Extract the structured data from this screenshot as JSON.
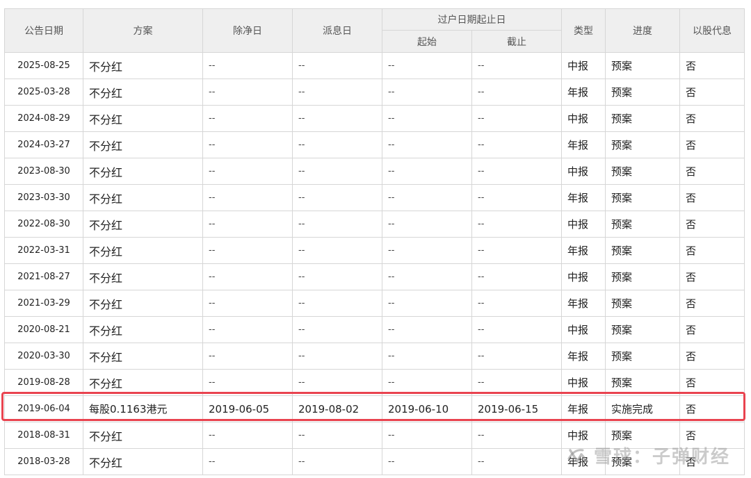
{
  "table": {
    "headers": {
      "announce_date": "公告日期",
      "plan": "方案",
      "ex_date": "除净日",
      "pay_date": "派息日",
      "transfer_period": "过户日期起止日",
      "transfer_start": "起始",
      "transfer_end": "截止",
      "type": "类型",
      "progress": "进度",
      "scrip": "以股代息"
    },
    "rows": [
      {
        "date": "2025-08-25",
        "plan": "不分红",
        "ex": "--",
        "pay": "--",
        "start": "--",
        "end": "--",
        "type": "中报",
        "progress": "预案",
        "scrip": "否"
      },
      {
        "date": "2025-03-28",
        "plan": "不分红",
        "ex": "--",
        "pay": "--",
        "start": "--",
        "end": "--",
        "type": "年报",
        "progress": "预案",
        "scrip": "否"
      },
      {
        "date": "2024-08-29",
        "plan": "不分红",
        "ex": "--",
        "pay": "--",
        "start": "--",
        "end": "--",
        "type": "中报",
        "progress": "预案",
        "scrip": "否"
      },
      {
        "date": "2024-03-27",
        "plan": "不分红",
        "ex": "--",
        "pay": "--",
        "start": "--",
        "end": "--",
        "type": "年报",
        "progress": "预案",
        "scrip": "否"
      },
      {
        "date": "2023-08-30",
        "plan": "不分红",
        "ex": "--",
        "pay": "--",
        "start": "--",
        "end": "--",
        "type": "中报",
        "progress": "预案",
        "scrip": "否"
      },
      {
        "date": "2023-03-30",
        "plan": "不分红",
        "ex": "--",
        "pay": "--",
        "start": "--",
        "end": "--",
        "type": "年报",
        "progress": "预案",
        "scrip": "否"
      },
      {
        "date": "2022-08-30",
        "plan": "不分红",
        "ex": "--",
        "pay": "--",
        "start": "--",
        "end": "--",
        "type": "中报",
        "progress": "预案",
        "scrip": "否"
      },
      {
        "date": "2022-03-31",
        "plan": "不分红",
        "ex": "--",
        "pay": "--",
        "start": "--",
        "end": "--",
        "type": "年报",
        "progress": "预案",
        "scrip": "否"
      },
      {
        "date": "2021-08-27",
        "plan": "不分红",
        "ex": "--",
        "pay": "--",
        "start": "--",
        "end": "--",
        "type": "中报",
        "progress": "预案",
        "scrip": "否"
      },
      {
        "date": "2021-03-29",
        "plan": "不分红",
        "ex": "--",
        "pay": "--",
        "start": "--",
        "end": "--",
        "type": "年报",
        "progress": "预案",
        "scrip": "否"
      },
      {
        "date": "2020-08-21",
        "plan": "不分红",
        "ex": "--",
        "pay": "--",
        "start": "--",
        "end": "--",
        "type": "中报",
        "progress": "预案",
        "scrip": "否"
      },
      {
        "date": "2020-03-30",
        "plan": "不分红",
        "ex": "--",
        "pay": "--",
        "start": "--",
        "end": "--",
        "type": "年报",
        "progress": "预案",
        "scrip": "否"
      },
      {
        "date": "2019-08-28",
        "plan": "不分红",
        "ex": "--",
        "pay": "--",
        "start": "--",
        "end": "--",
        "type": "中报",
        "progress": "预案",
        "scrip": "否"
      },
      {
        "date": "2019-06-04",
        "plan": "每股0.1163港元",
        "ex": "2019-06-05",
        "pay": "2019-08-02",
        "start": "2019-06-10",
        "end": "2019-06-15",
        "type": "年报",
        "progress": "实施完成",
        "scrip": "否",
        "highlighted": true
      },
      {
        "date": "2018-08-31",
        "plan": "不分红",
        "ex": "--",
        "pay": "--",
        "start": "--",
        "end": "--",
        "type": "中报",
        "progress": "预案",
        "scrip": "否"
      },
      {
        "date": "2018-03-28",
        "plan": "不分红",
        "ex": "--",
        "pay": "--",
        "start": "--",
        "end": "--",
        "type": "年报",
        "progress": "预案",
        "scrip": "否"
      }
    ]
  },
  "watermark": {
    "text": "雪球：子弹财经",
    "icon": "snowball-logo-icon"
  },
  "colors": {
    "highlight_border": "#e9434f",
    "header_bg": "#efefef",
    "grid": "#d6d6d6"
  }
}
